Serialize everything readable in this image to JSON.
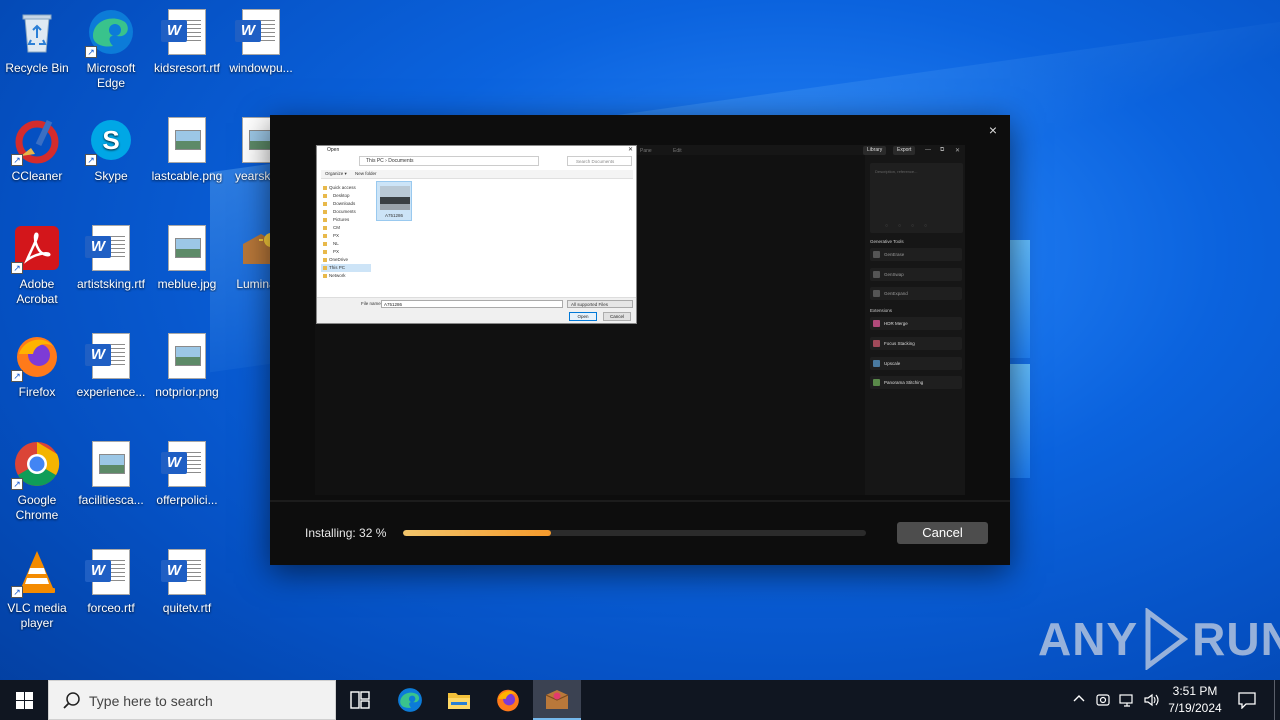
{
  "desktop": {
    "icons": [
      {
        "label": "Recycle Bin",
        "icon": "recycle-bin-icon"
      },
      {
        "label": "Microsoft Edge",
        "icon": "edge-icon"
      },
      {
        "label": "kidsresort.rtf",
        "icon": "word-doc-icon"
      },
      {
        "label": "windowpu...",
        "icon": "word-doc-icon"
      },
      {
        "label": "CCleaner",
        "icon": "ccleaner-icon"
      },
      {
        "label": "Skype",
        "icon": "skype-icon"
      },
      {
        "label": "lastcable.png",
        "icon": "image-file-icon"
      },
      {
        "label": "yearskb...",
        "icon": "image-file-icon"
      },
      {
        "label": "Adobe Acrobat",
        "icon": "acrobat-icon"
      },
      {
        "label": "artistsking.rtf",
        "icon": "word-doc-icon"
      },
      {
        "label": "meblue.jpg",
        "icon": "image-file-icon"
      },
      {
        "label": "Lumina...",
        "icon": "luminar-icon"
      },
      {
        "label": "Firefox",
        "icon": "firefox-icon"
      },
      {
        "label": "experience...",
        "icon": "word-doc-icon"
      },
      {
        "label": "notprior.png",
        "icon": "image-file-icon"
      },
      {
        "label": "Google Chrome",
        "icon": "chrome-icon"
      },
      {
        "label": "facilitiesca...",
        "icon": "image-file-icon"
      },
      {
        "label": "offerpolici...",
        "icon": "word-doc-icon"
      },
      {
        "label": "VLC media player",
        "icon": "vlc-icon"
      },
      {
        "label": "forceo.rtf",
        "icon": "word-doc-icon"
      },
      {
        "label": "quitetv.rtf",
        "icon": "word-doc-icon"
      }
    ]
  },
  "installer": {
    "close_label": "×",
    "status_text": "Installing: 32 %",
    "progress": 0.32,
    "cancel_label": "Cancel",
    "preview": {
      "top_texts": [
        "Pane",
        "Edit"
      ],
      "top_buttons": [
        "Library",
        "Export"
      ],
      "window_controls": [
        "—",
        "⧉",
        "✕"
      ],
      "panel_placeholder": "Description, reference...",
      "generative_title": "Generative Tools",
      "generative_items": [
        "GenErase",
        "GenSwap",
        "GenExpand"
      ],
      "extensions_title": "Extensions",
      "extension_items": [
        "HDR Merge",
        "Focus Stacking",
        "Upscale",
        "Panorama Stitching"
      ],
      "dialog": {
        "title": "Open",
        "close": "✕",
        "address": "This PC › Documents",
        "search_placeholder": "Search Documents",
        "toolbar_organize": "Organize ▾",
        "toolbar_new_folder": "New folder",
        "nav_items": [
          "Quick access",
          "Desktop",
          "Downloads",
          "Documents",
          "Pictures",
          "CM",
          "PX",
          "NL",
          "PX",
          "OneDrive",
          "This PC",
          "Network"
        ],
        "file_name": "A751286",
        "file_name_label": "File name:",
        "file_name_value": "A751286",
        "filter": "All supported Files",
        "open_label": "Open",
        "cancel_label": "Cancel"
      }
    }
  },
  "watermark": {
    "left": "ANY",
    "right": "RUN"
  },
  "taskbar": {
    "search_placeholder": "Type here to search",
    "time": "3:51 PM",
    "date": "7/19/2024",
    "pinned": [
      "task-view-icon",
      "edge-icon",
      "file-explorer-icon",
      "firefox-icon",
      "installer-app-icon"
    ],
    "tray": [
      "chevron-up-icon",
      "meet-now-icon",
      "network-icon",
      "volume-icon"
    ]
  },
  "colors": {
    "progress_start": "#f2c56b",
    "progress_end": "#f59a2c",
    "taskbar": "#101621",
    "desktop_blue": "#0b63de"
  }
}
